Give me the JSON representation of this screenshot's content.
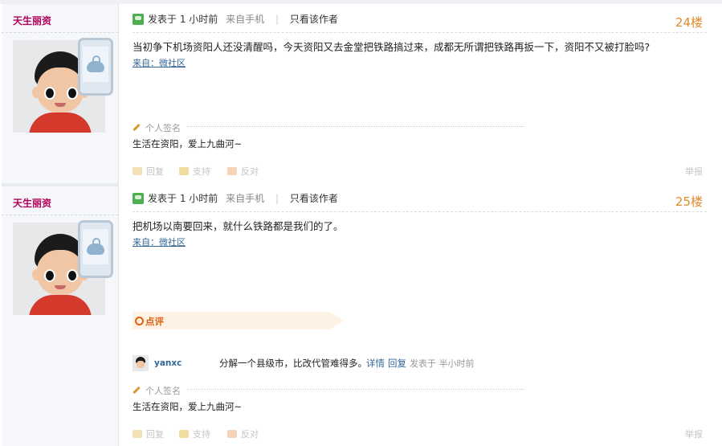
{
  "posts": [
    {
      "username": "天生丽资",
      "posted_label": "发表于",
      "time": "1 小时前",
      "from": "来自手机",
      "author_only": "只看该作者",
      "floor": "24楼",
      "content": "当初争下机场资阳人还没清醒吗，今天资阳又去金堂把铁路搞过来，成都无所谓把铁路再扳一下，资阳不又被打脸吗?",
      "source": "来自：微社区",
      "signature_label": "个人签名",
      "signature": "生活在资阳，爱上九曲河~",
      "actions": {
        "reply": "回复",
        "support": "支持",
        "oppose": "反对",
        "report": "举报"
      }
    },
    {
      "username": "天生丽资",
      "posted_label": "发表于",
      "time": "1 小时前",
      "from": "来自手机",
      "author_only": "只看该作者",
      "floor": "25楼",
      "content": "把机场以南要回来，就什么铁路都是我们的了。",
      "source": "来自：微社区",
      "comment_label": "点评",
      "comment": {
        "user": "yanxc",
        "text": "分解一个县级市，比改代管难得多。",
        "detail": "详情",
        "reply": "回复",
        "posted": "发表于 半小时前"
      },
      "signature_label": "个人签名",
      "signature": "生活在资阳，爱上九曲河~",
      "actions": {
        "reply": "回复",
        "support": "支持",
        "oppose": "反对",
        "report": "举报"
      }
    }
  ]
}
